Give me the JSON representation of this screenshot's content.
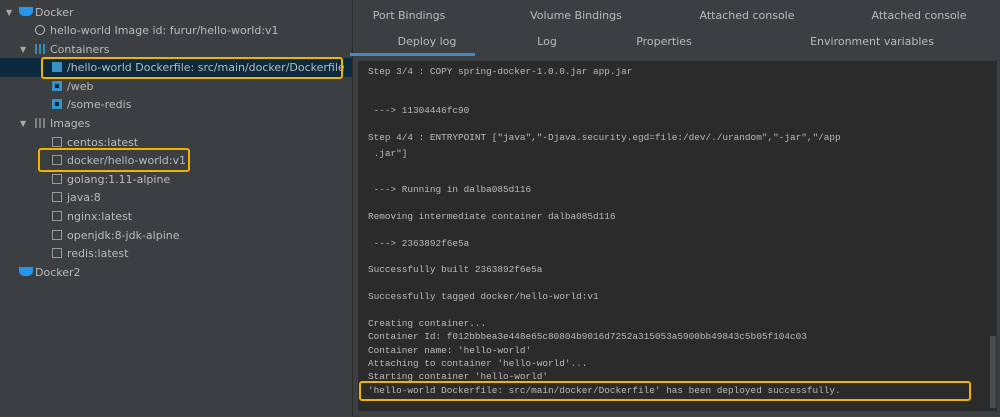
{
  "tree": {
    "docker": "Docker",
    "image_info": "hello-world Image id: furur/hello-world:v1",
    "containers": "Containers",
    "container_items": [
      "/hello-world Dockerfile: src/main/docker/Dockerfile",
      "/web",
      "/some-redis"
    ],
    "images": "Images",
    "image_items": [
      "centos:latest",
      "docker/hello-world:v1",
      "golang:1.11-alpine",
      "java:8",
      "nginx:latest",
      "openjdk:8-jdk-alpine",
      "redis:latest"
    ],
    "docker2": "Docker2"
  },
  "tabs": {
    "row1": [
      "Port Bindings",
      "Volume Bindings",
      "Attached console",
      "Attached console"
    ],
    "row2": [
      "Deploy log",
      "Log",
      "Properties",
      "Environment variables"
    ],
    "active": "Deploy log"
  },
  "log": [
    "Step 3/4 : COPY spring-docker-1.0.0.jar app.jar",
    " ---> 11304446fc90",
    "Step 4/4 : ENTRYPOINT [\"java\",\"-Djava.security.egd=file:/dev/./urandom\",\"-jar\",\"/app",
    " .jar\"]",
    " ---> Running in dalba085d116",
    "Removing intermediate container dalba085d116",
    " ---> 2363892f6e5a",
    "Successfully built 2363892f6e5a",
    "Successfully tagged docker/hello-world:v1",
    "Creating container...",
    "Container Id: f012bbbea3e448e65c80804b9016d7252a315053a5900bb49843c5b05f104c03",
    "Container name: 'hello-world'",
    "Attaching to container 'hello-world'...",
    "Starting container 'hello-world'",
    "'hello-world Dockerfile: src/main/docker/Dockerfile' has been deployed successfully."
  ],
  "colors": {
    "highlight": "#f0b400",
    "accent": "#4a88c7",
    "selected": "#0d293e"
  }
}
